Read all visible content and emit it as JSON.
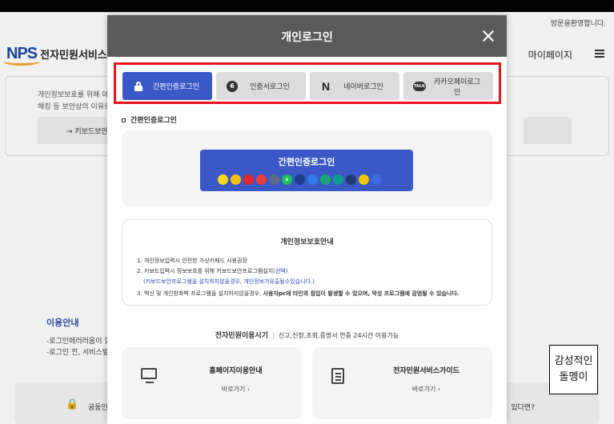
{
  "top": {
    "welcome": "방문을환영합니다."
  },
  "header": {
    "logo_mark": "NPS",
    "logo_text": "전자민원서비스",
    "mypage": "마이페이지"
  },
  "background": {
    "intro_line1": "개인정보보호를 위해 아래",
    "intro_line2": "해킹 등 보안상의 이유로 키",
    "keyboard_button": "→ 키보드보안",
    "info_title": "이용안내",
    "info_line1": "-로그인에러러움이 있으",
    "info_line2": "-로그인 전, 서비스별 표",
    "common_text": "공동인",
    "right_question": "있다면?"
  },
  "modal": {
    "title": "개인로그인",
    "tabs": [
      {
        "label": "간편인증로그인",
        "icon": "lock-icon",
        "active": true
      },
      {
        "label": "인증서로그인",
        "icon": "certificate-icon",
        "active": false
      },
      {
        "label": "네이버로그인",
        "icon": "naver-icon",
        "active": false
      },
      {
        "label": "카카오페이로그인",
        "icon": "kakao-talk-icon",
        "active": false
      }
    ],
    "tab_icon_text": {
      "cert": "6",
      "naver": "N",
      "talk": "TALK"
    },
    "section_title": "간편인증로그인",
    "simple_button": "간편인증로그인",
    "providers": [
      {
        "name": "kakao",
        "color": "#f9d71c",
        "text": ""
      },
      {
        "name": "pass",
        "color": "#f4c20d",
        "text": ""
      },
      {
        "name": "payco",
        "color": "#e8262b",
        "text": ""
      },
      {
        "name": "samsung",
        "color": "#e83e3e",
        "text": ""
      },
      {
        "name": "kb",
        "color": "#5b6a86",
        "text": ""
      },
      {
        "name": "naver",
        "color": "#19c35a",
        "text": "N"
      },
      {
        "name": "shinhan",
        "color": "#1a3e8c",
        "text": ""
      },
      {
        "name": "toss",
        "color": "#2b7de9",
        "text": ""
      },
      {
        "name": "bank",
        "color": "#19a974",
        "text": ""
      },
      {
        "name": "hana",
        "color": "#0b9e8f",
        "text": ""
      },
      {
        "name": "nh",
        "color": "#1e3a6d",
        "text": ""
      },
      {
        "name": "kbank",
        "color": "#f2c800",
        "text": ""
      },
      {
        "name": "banksalad",
        "color": "#3b6be0",
        "text": ""
      }
    ],
    "notice": {
      "title": "개인정보보호안내",
      "item1": "1. 개인정보입력시 안전한 가상키패드 사용권장",
      "item2a": "2. 키보드입력시 정보보호를 위해 키보드보안프로그램설치",
      "item2b": "(선택)",
      "item2c": "(키보드보안프로그램을 설치하지않을경우, 개인정보가유출될수있습니다.)",
      "item3a": "3. 백신 및 개인방화벽 프로그램을 설치하지않을경우, ",
      "item3b": "사용자pc에 타인의 침입이 발생할 수 있으며, 악성 프로그램에 감염될 수 있습니다."
    },
    "hours": {
      "label": "전자민원이용시기",
      "text": "신고,신청,조회,증명서 연중 24시간 이용가능"
    },
    "guides": [
      {
        "title": "홈페이지이용안내",
        "link": "바로가기 ›",
        "icon": "monitor-icon"
      },
      {
        "title": "전자민원서비스가이드",
        "link": "바로가기 ›",
        "icon": "book-icon"
      }
    ]
  },
  "stamp": {
    "line1": "감성적인",
    "line2": "돌멩이"
  }
}
